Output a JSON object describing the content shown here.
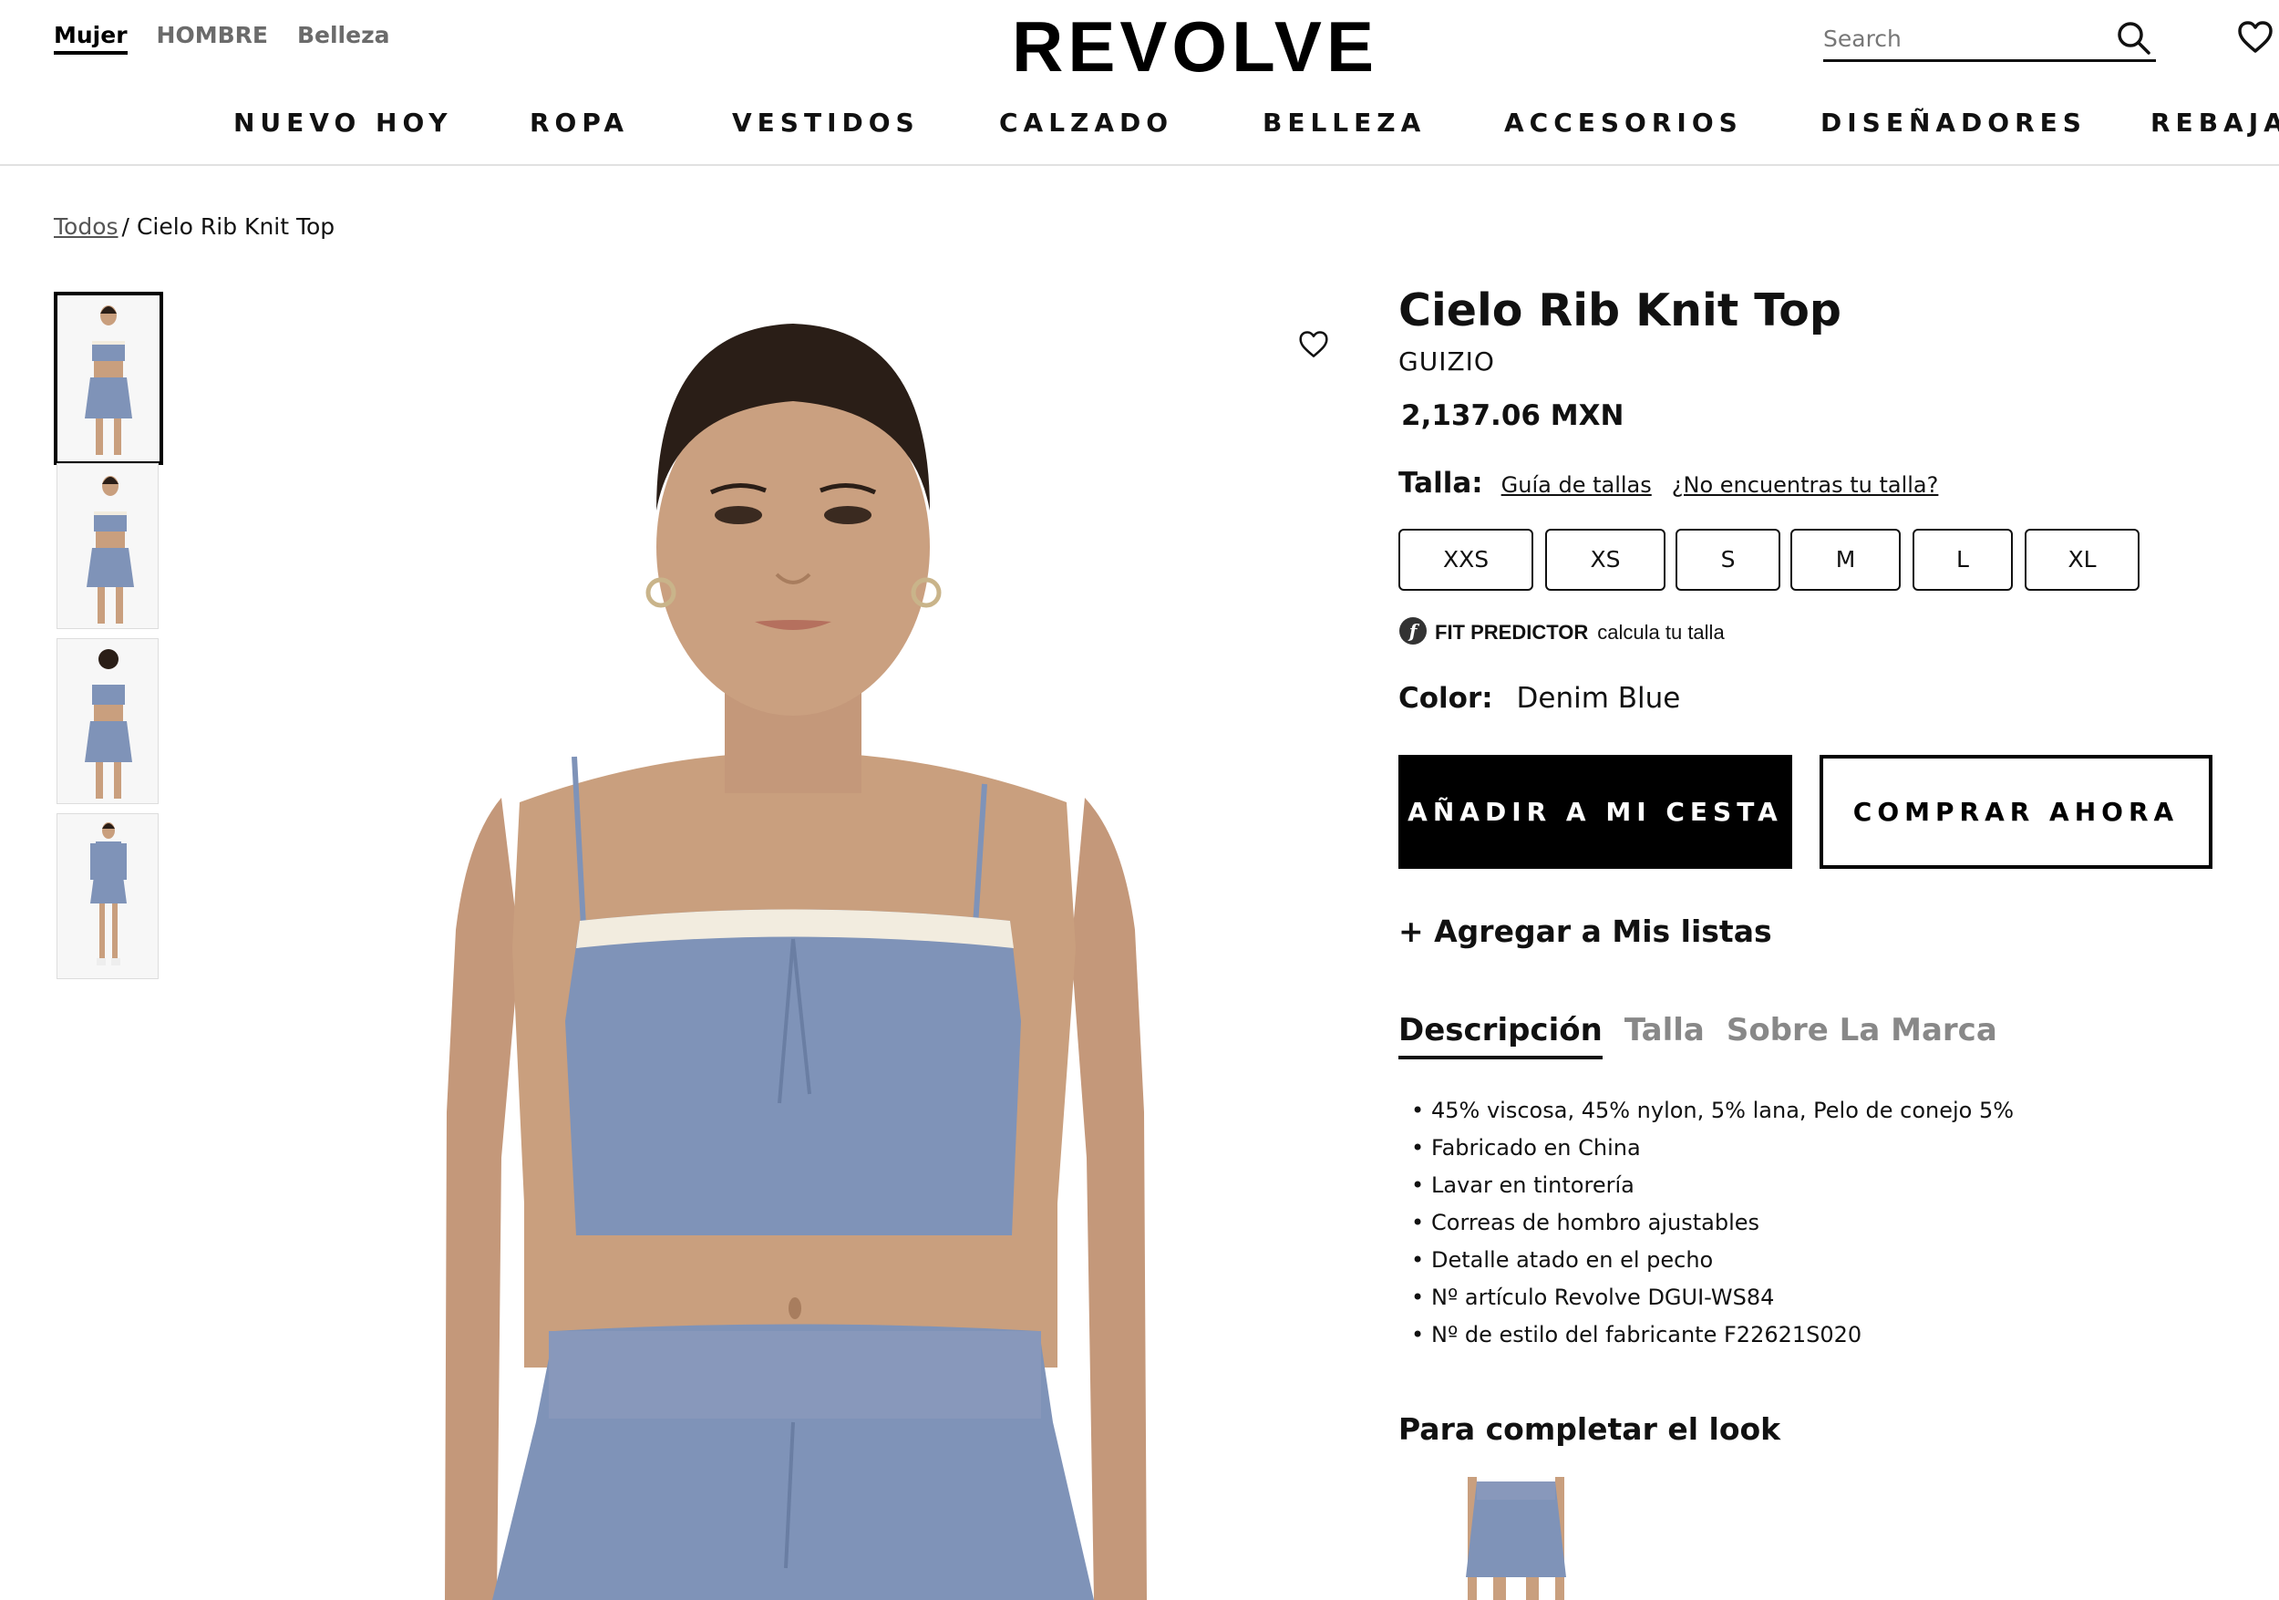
{
  "header": {
    "top_links": [
      "Mujer",
      "HOMBRE",
      "Belleza"
    ],
    "logo": "REVOLVE",
    "search_placeholder": "Search"
  },
  "nav": {
    "items": [
      "NUEVO HOY",
      "ROPA",
      "VESTIDOS",
      "CALZADO",
      "BELLEZA",
      "ACCESORIOS",
      "DISEÑADORES",
      "REBAJA"
    ]
  },
  "breadcrumb": {
    "root": "Todos",
    "separator": "/",
    "current": "Cielo Rib Knit Top"
  },
  "product": {
    "title": "Cielo Rib Knit Top",
    "brand": "GUIZIO",
    "price": "2,137.06 MXN",
    "size_label": "Talla:",
    "size_guide_link": "Guía de tallas",
    "size_help_link": "¿No encuentras tu talla?",
    "sizes": [
      "XXS",
      "XS",
      "S",
      "M",
      "L",
      "XL"
    ],
    "fit_predictor": "FIT PREDICTOR",
    "fit_predictor_text": "calcula tu talla",
    "color_label": "Color:",
    "color_value": "Denim Blue",
    "add_to_cart": "AÑADIR A MI CESTA",
    "buy_now": "COMPRAR AHORA",
    "add_to_list": "+ Agregar a Mis listas"
  },
  "tabs": [
    "Descripción",
    "Talla",
    "Sobre La Marca"
  ],
  "description": [
    "45% viscosa, 45% nylon, 5% lana, Pelo de conejo 5%",
    "Fabricado en China",
    "Lavar en tintorería",
    "Correas de hombro ajustables",
    "Detalle atado en el pecho",
    "Nº artículo Revolve DGUI-WS84",
    "Nº de estilo del fabricante F22621S020"
  ],
  "complete_look": {
    "title": "Para completar el look"
  },
  "colors": {
    "denim_blue": "#7f93b8",
    "skin": "#c99f7e",
    "hair": "#2a1e17"
  },
  "icons": {
    "search": "search-icon",
    "wishlist": "heart-icon",
    "fit_predictor": "fit-predictor-icon"
  }
}
